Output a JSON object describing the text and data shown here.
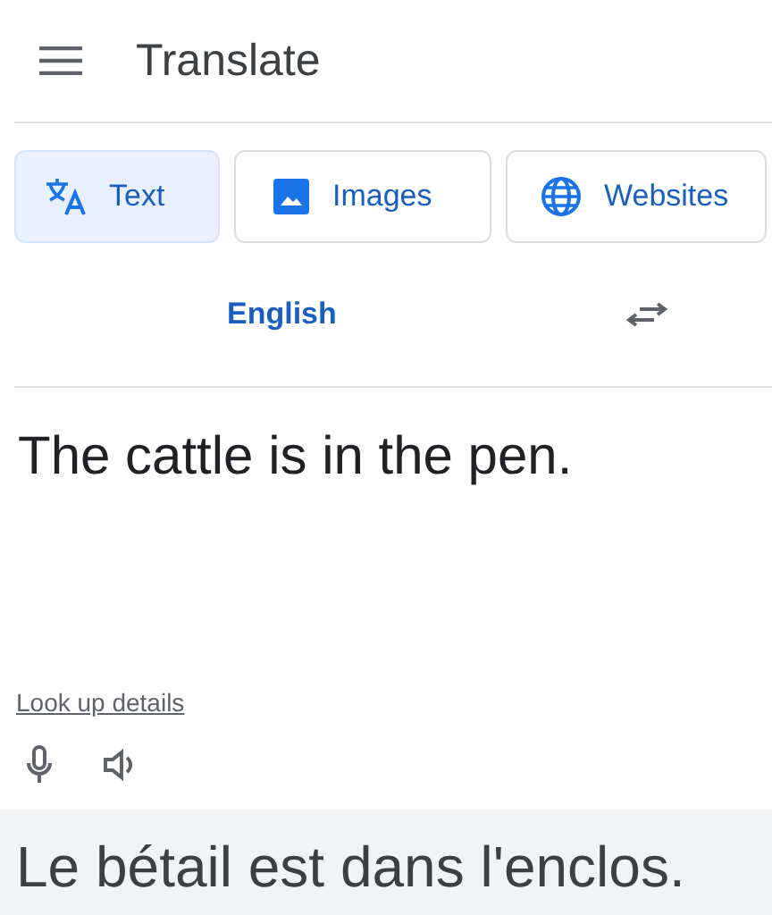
{
  "header": {
    "title": "Translate"
  },
  "tabs": [
    {
      "label": "Text",
      "kind": "text",
      "selected": true
    },
    {
      "label": "Images",
      "kind": "images",
      "selected": false
    },
    {
      "label": "Websites",
      "kind": "websites",
      "selected": false
    }
  ],
  "languages": {
    "source": "English"
  },
  "source": {
    "text": "The cattle is in the pen.",
    "link": "Look up details"
  },
  "output": {
    "text": "Le bétail est dans l'enclos."
  }
}
